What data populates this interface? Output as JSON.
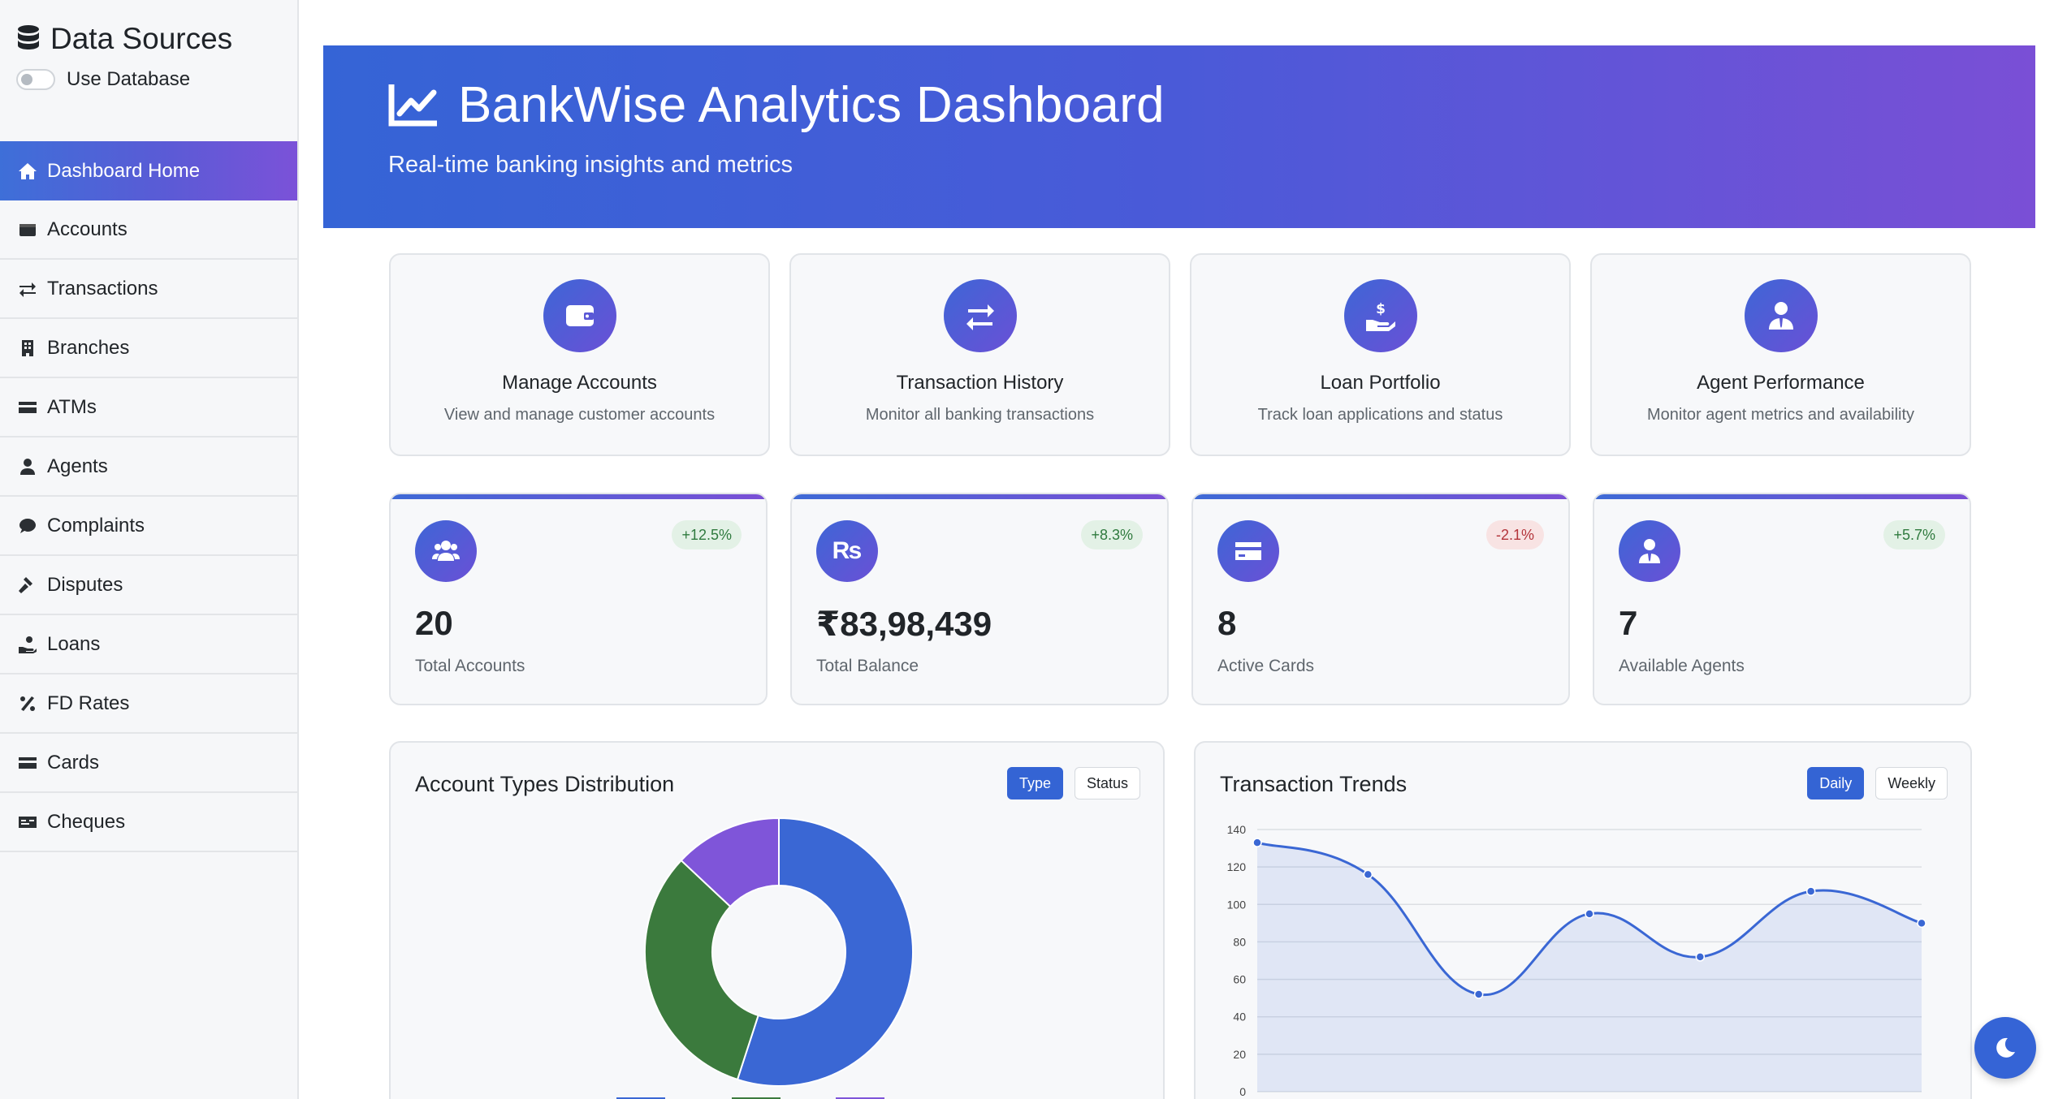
{
  "sidebar": {
    "title": "Data Sources",
    "toggle_label": "Use Database",
    "items": [
      {
        "label": "Dashboard Home",
        "icon": "home-icon"
      },
      {
        "label": "Accounts",
        "icon": "wallet-icon"
      },
      {
        "label": "Transactions",
        "icon": "exchange-icon"
      },
      {
        "label": "Branches",
        "icon": "building-icon"
      },
      {
        "label": "ATMs",
        "icon": "credit-card-icon"
      },
      {
        "label": "Agents",
        "icon": "user-tie-icon"
      },
      {
        "label": "Complaints",
        "icon": "comment-icon"
      },
      {
        "label": "Disputes",
        "icon": "gavel-icon"
      },
      {
        "label": "Loans",
        "icon": "hand-holding-dollar-icon"
      },
      {
        "label": "FD Rates",
        "icon": "percent-icon"
      },
      {
        "label": "Cards",
        "icon": "credit-card-icon"
      },
      {
        "label": "Cheques",
        "icon": "money-check-icon"
      }
    ]
  },
  "header": {
    "title": "BankWise Analytics Dashboard",
    "subtitle": "Real-time banking insights and metrics",
    "icon": "chart-line-icon"
  },
  "quick_actions": [
    {
      "title": "Manage Accounts",
      "desc": "View and manage customer accounts",
      "icon": "wallet-icon"
    },
    {
      "title": "Transaction History",
      "desc": "Monitor all banking transactions",
      "icon": "exchange-icon"
    },
    {
      "title": "Loan Portfolio",
      "desc": "Track loan applications and status",
      "icon": "hand-holding-dollar-icon"
    },
    {
      "title": "Agent Performance",
      "desc": "Monitor agent metrics and availability",
      "icon": "user-tie-icon"
    }
  ],
  "stats": [
    {
      "value": "20",
      "label": "Total Accounts",
      "change": "+12.5%",
      "trend": "positive",
      "icon": "users-icon"
    },
    {
      "value": "₹83,98,439",
      "label": "Total Balance",
      "change": "+8.3%",
      "trend": "positive",
      "icon": "rupee-icon"
    },
    {
      "value": "8",
      "label": "Active Cards",
      "change": "-2.1%",
      "trend": "negative",
      "icon": "credit-card-icon"
    },
    {
      "value": "7",
      "label": "Available Agents",
      "change": "+5.7%",
      "trend": "positive",
      "icon": "user-tie-icon"
    }
  ],
  "rupee_glyph": "₨",
  "account_chart": {
    "title": "Account Types Distribution",
    "buttons": [
      "Type",
      "Status"
    ],
    "active": "Type"
  },
  "trend_chart": {
    "title": "Transaction Trends",
    "buttons": [
      "Daily",
      "Weekly"
    ],
    "active": "Daily"
  },
  "colors": {
    "accent": "#3564d6",
    "accent_purple": "#7a4fd6",
    "donut": [
      "#3a67d4",
      "#3b7a3d",
      "#7f55d9"
    ],
    "line": "#3a67d4"
  },
  "chart_data": [
    {
      "type": "pie",
      "title": "Account Types Distribution",
      "categories": [
        "",
        "",
        ""
      ],
      "values": [
        55,
        32,
        13
      ]
    },
    {
      "type": "line",
      "title": "Transaction Trends",
      "x": [
        1,
        2,
        3,
        4,
        5,
        6,
        7
      ],
      "values": [
        133,
        116,
        52,
        95,
        72,
        107,
        90
      ],
      "ylim": [
        0,
        140
      ],
      "yticks": [
        0,
        20,
        40,
        60,
        80,
        100,
        120,
        140
      ],
      "grid": true
    }
  ],
  "theme_toggle_icon": "moon-icon"
}
